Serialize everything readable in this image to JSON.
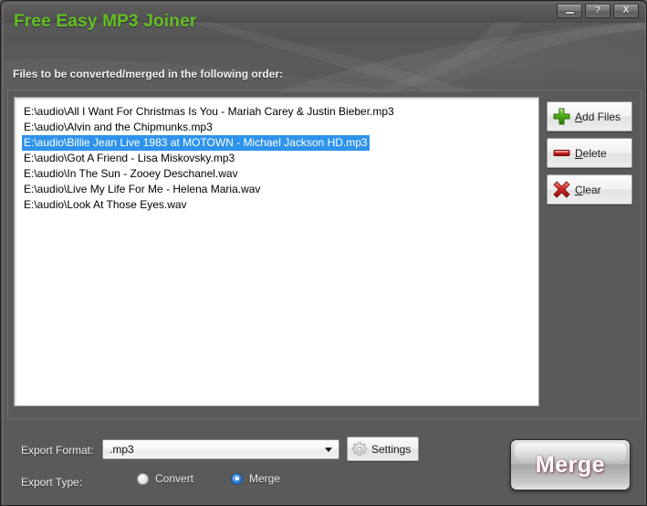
{
  "window": {
    "title": "Free Easy MP3 Joiner",
    "accent_green": "#63c023",
    "background": "#5a5a5a",
    "selection_blue": "#2e93ec",
    "buttons": [
      {
        "name": "minimize",
        "glyph": "minimize-icon",
        "label": ""
      },
      {
        "name": "help",
        "glyph": "help-icon",
        "label": "?"
      },
      {
        "name": "close",
        "glyph": "close-icon",
        "label": "X"
      }
    ]
  },
  "main": {
    "section_label": "Files to be converted/merged in the following order:",
    "files": [
      {
        "path": "E:\\audio\\All I Want For Christmas Is You - Mariah Carey & Justin Bieber.mp3",
        "selected": false
      },
      {
        "path": "E:\\audio\\Alvin and the Chipmunks.mp3",
        "selected": false
      },
      {
        "path": "E:\\audio\\Billie Jean Live 1983 at MOTOWN - Michael Jackson HD.mp3",
        "selected": true
      },
      {
        "path": "E:\\audio\\Got A Friend - Lisa Miskovsky.mp3",
        "selected": false
      },
      {
        "path": "E:\\audio\\In The Sun - Zooey Deschanel.wav",
        "selected": false
      },
      {
        "path": "E:\\audio\\Live My Life For Me - Helena Maria.wav",
        "selected": false
      },
      {
        "path": "E:\\audio\\Look At Those Eyes.wav",
        "selected": false
      }
    ]
  },
  "side_buttons": {
    "add_files": {
      "label_pre": "",
      "accel": "A",
      "label_post": "dd Files",
      "icon": "plus-icon"
    },
    "delete": {
      "label_pre": "",
      "accel": "D",
      "label_post": "elete",
      "icon": "minus-icon"
    },
    "clear": {
      "label_pre": "",
      "accel": "C",
      "label_post": "lear",
      "icon": "cross-icon"
    }
  },
  "bottom": {
    "export_format_label": "Export Format:",
    "export_format_value": ".mp3",
    "settings_label": "Settings",
    "export_type_label": "Export Type:",
    "radio_convert_label": "Convert",
    "radio_merge_label": "Merge",
    "merge_button_label": "Merge"
  }
}
